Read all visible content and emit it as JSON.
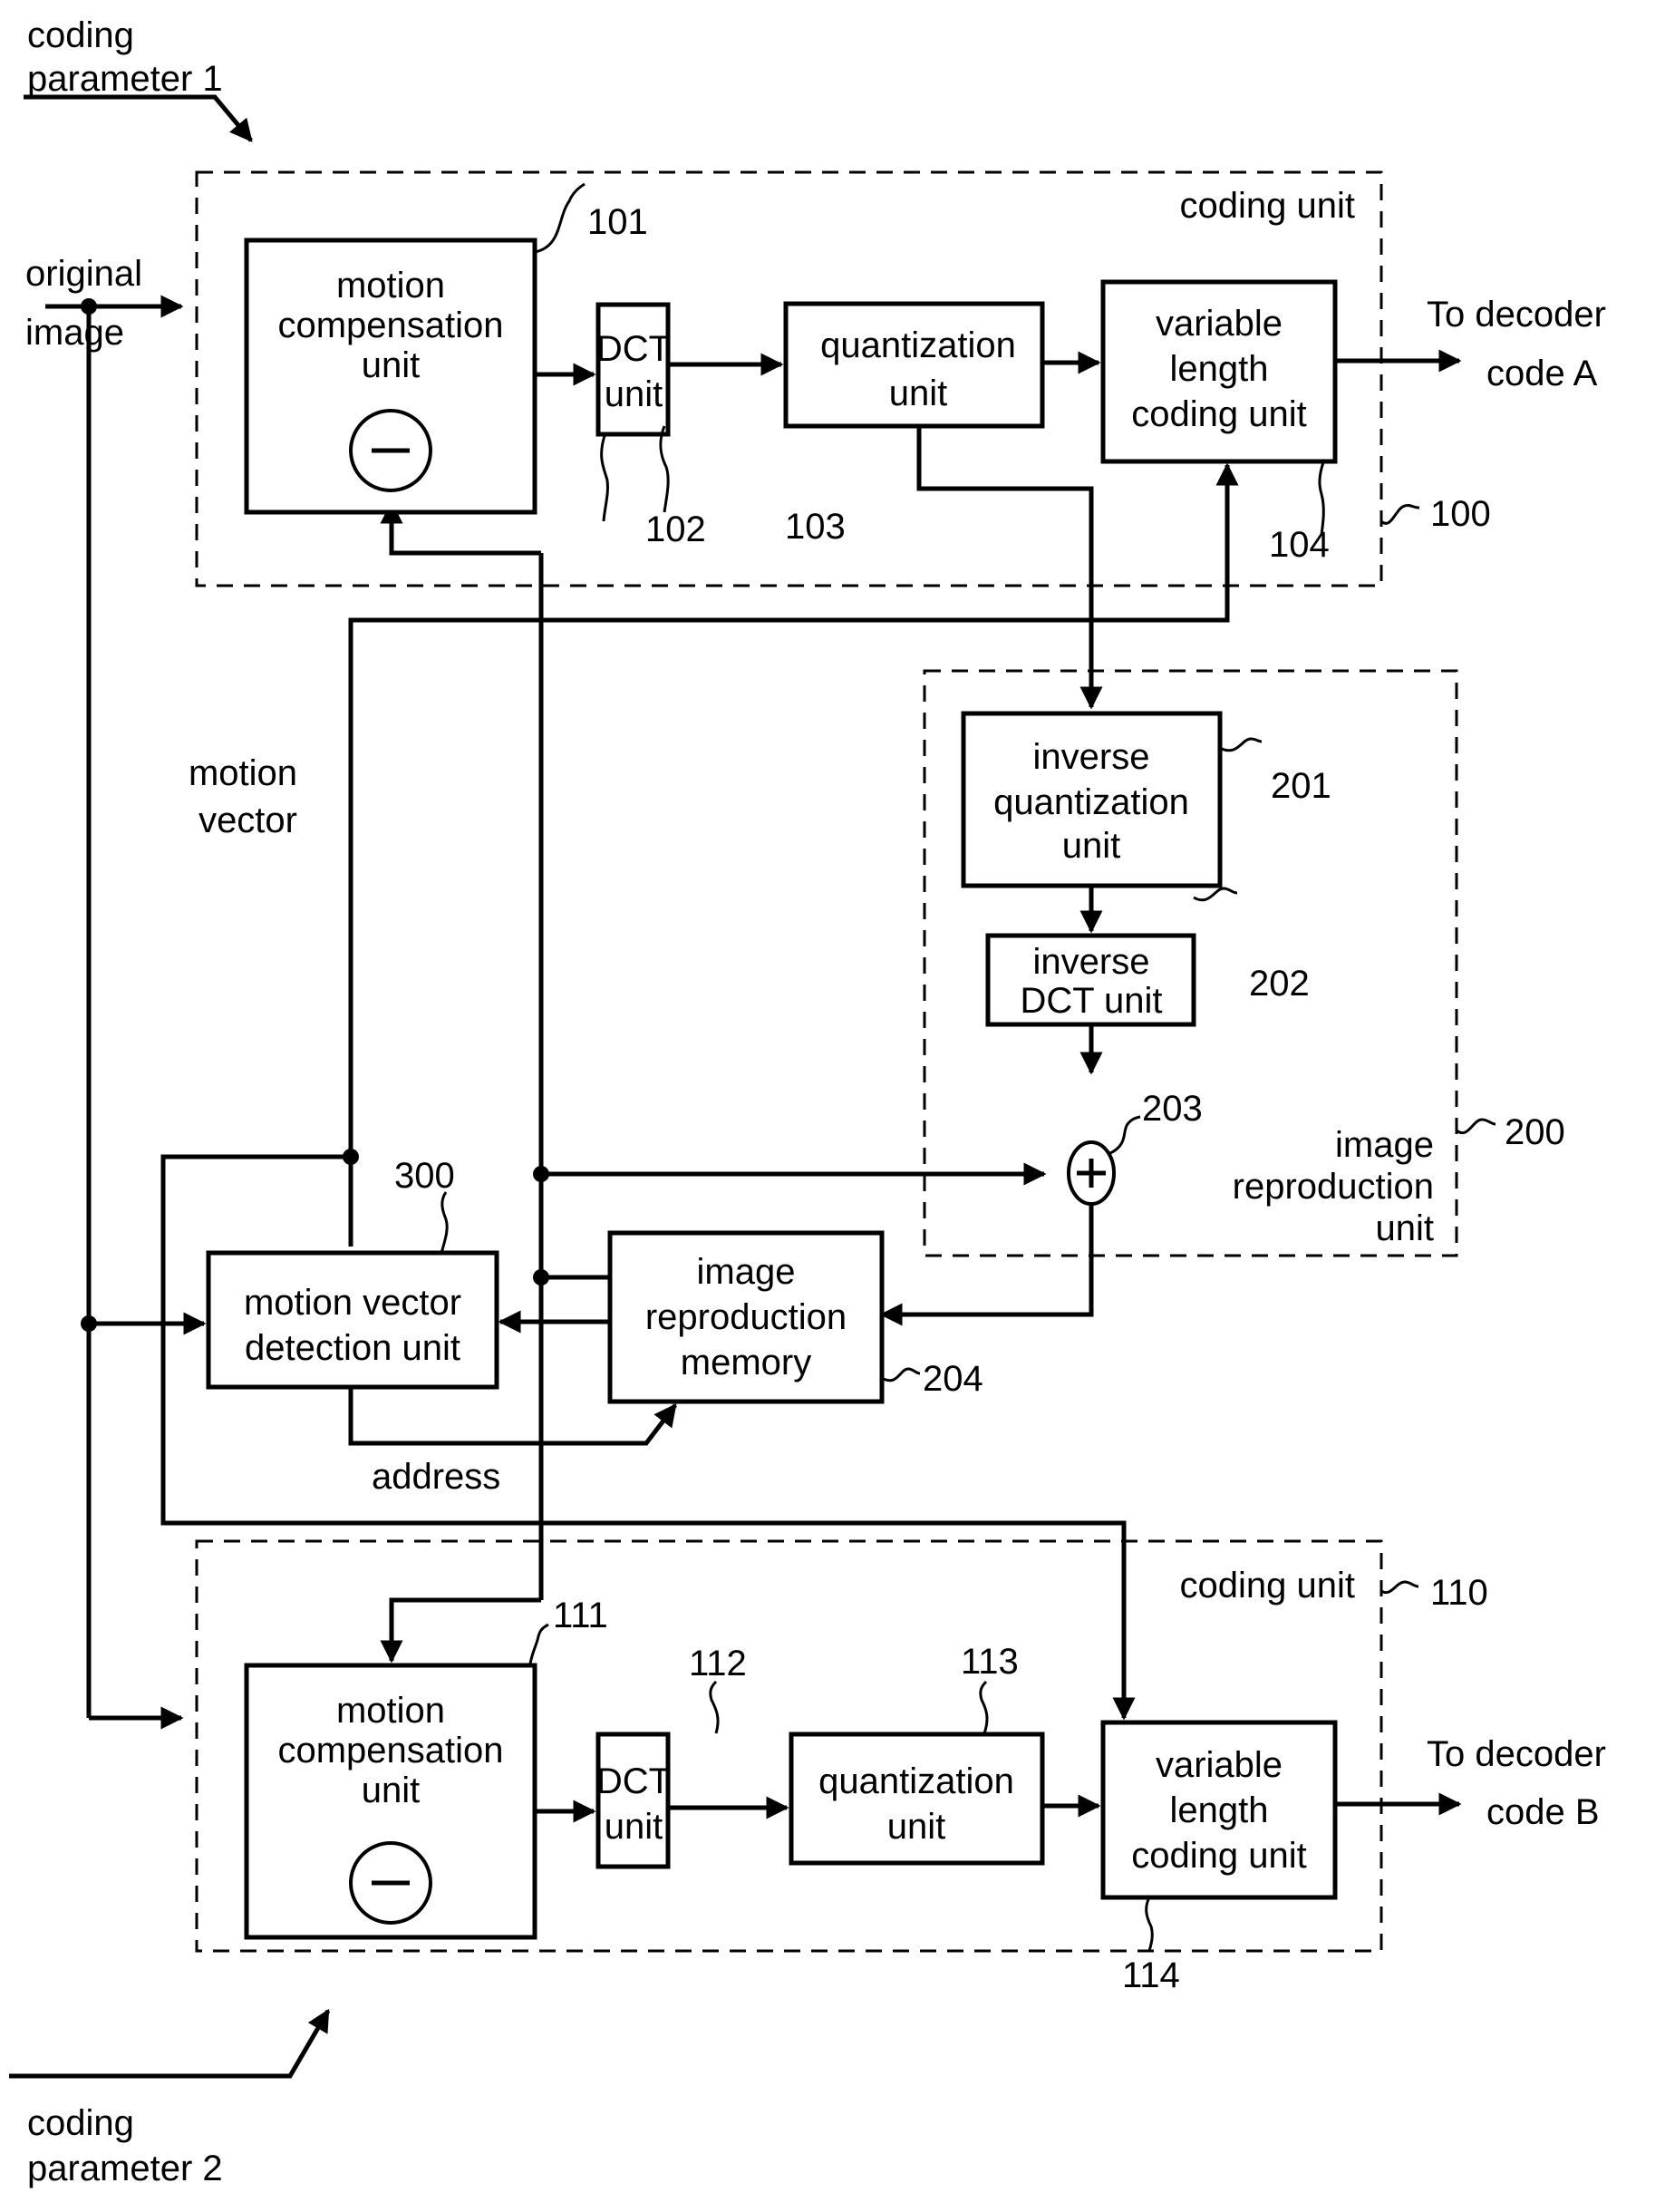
{
  "diagram": {
    "inputs": {
      "coding_parameter_1": [
        "coding",
        "parameter 1"
      ],
      "coding_parameter_2": [
        "coding",
        "parameter 2"
      ],
      "original_image": [
        "original",
        "image"
      ]
    },
    "outputs": {
      "to_decoder_a": [
        "To decoder",
        "code A"
      ],
      "to_decoder_b": [
        "To decoder",
        "code B"
      ]
    },
    "groups": {
      "coding_unit_100": {
        "title": "coding unit",
        "ref": "100"
      },
      "image_reproduction_unit_200": {
        "title": [
          "image",
          "reproduction",
          "unit"
        ],
        "ref": "200"
      },
      "coding_unit_110": {
        "title": "coding unit",
        "ref": "110"
      }
    },
    "blocks": {
      "mc_101": {
        "lines": [
          "motion",
          "compensation",
          "unit"
        ],
        "ref": "101",
        "symbol": "−"
      },
      "dct_102": {
        "lines": [
          "DCT",
          "unit"
        ],
        "ref": "102"
      },
      "quant_103": {
        "lines": [
          "quantization",
          "unit"
        ],
        "ref": "103"
      },
      "vlc_104": {
        "lines": [
          "variable",
          "length",
          "coding unit"
        ],
        "ref": "104"
      },
      "iquant_201": {
        "lines": [
          "inverse",
          "quantization",
          "unit"
        ],
        "ref": "201"
      },
      "idct_202": {
        "lines": [
          "inverse",
          "DCT unit"
        ],
        "ref": "202"
      },
      "adder_203": {
        "symbol": "+",
        "ref": "203"
      },
      "memory_204": {
        "lines": [
          "image",
          "reproduction",
          "memory"
        ],
        "ref": "204"
      },
      "mvd_300": {
        "lines": [
          "motion vector",
          "detection unit"
        ],
        "ref": "300"
      },
      "mc_111": {
        "lines": [
          "motion",
          "compensation",
          "unit"
        ],
        "ref": "111",
        "symbol": "−"
      },
      "dct_112": {
        "lines": [
          "DCT",
          "unit"
        ],
        "ref": "112"
      },
      "quant_113": {
        "lines": [
          "quantization",
          "unit"
        ],
        "ref": "113"
      },
      "vlc_114": {
        "lines": [
          "variable",
          "length",
          "coding unit"
        ],
        "ref": "114"
      }
    },
    "signals": {
      "motion_vector": [
        "motion",
        "vector"
      ],
      "address": "address"
    }
  }
}
